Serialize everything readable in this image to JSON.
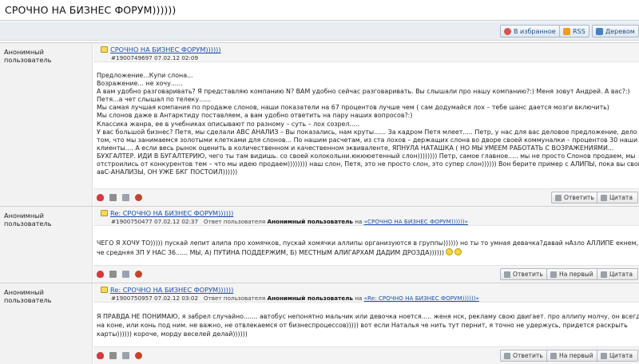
{
  "page": {
    "title": "СРОЧНО НА БИЗНЕС ФОРУМ))))))"
  },
  "actions": {
    "favorites": "В избранное",
    "rss": "RSS",
    "tree": "Деревом"
  },
  "labels": {
    "answered_by": "Ответ пользователя",
    "on": "на",
    "reply": "Ответить",
    "first": "На первый",
    "quote": "Цитата"
  },
  "posts": [
    {
      "author": "Анонимный пользователь",
      "subject": "СРОЧНО НА БИЗНЕС ФОРУМ))))))",
      "meta": "#1900749697 07.02.12 02:09",
      "lines": [
        "Предложение...Купи слона...",
        "Возражение... не хочу......",
        "А вам удобно разговаривать? Я представляю компанию N? ВАМ удобно сейчас разговаривать. Вы слышали про нашу компанию?:) Меня зовут Андрей. А вас?:)",
        "Петя...а чет слышал по телеку......",
        "Мы самая лучшая компания по продаже слонов, наши показатели на 67 процентов лучше чем ( сам додумайся лох – тебе шанс дается мозги включить)",
        "Мы слонов даже в Антарктиду поставляем, а вам удобно ответить на пару наших вопросов?:)",
        "Классика жанра, ее в учебниках описывают по разному – суть – лох созрел.....",
        "У вас большой бизнес? Петя, мы сделали АВС АНАЛИЗ – Вы показались, нам круты...... За кадром Петя млеет..... Петр, у нас для вас деловое предложение, дело в",
        "том, что мы занимаемся золотыми клетками для слонов... По нашим расчетам, из ста лохов – держащих слона во дворе своей коммуналки – процентов 30 наши",
        "клиенты.... А если весь рынок оценить в количественном и качественном эквиваленте, ЯПНУЛА НАТАШКА ( НО МЫ УМЕЕМ РАБОТАТЬ С ВОЗРАЖЕНИЯМИ...",
        "БУХГАЛТЕР. ИДИ В БУГАЛТЕРИЮ, чего ты там видишь. со своей колокольни.юкююетенный слон)))))))) Петр, самое главное..... мы не просто Слонов продаем, мы",
        "отстроились от конкурентов тем – что мы идею продаем)))))))) наш слон, Петя, это не просто слон, это супер слон)))))) Вон берите пример с АЛИПЫ, пока вы свои",
        "авС-АНАЛИЗЫ, ОН УЖЕ БКГ ПОСТОИЛ))))))"
      ]
    },
    {
      "author": "Анонимный пользователь",
      "subject": "Re: СРОЧНО НА БИЗНЕС ФОРУМ))))))",
      "meta_id": "#1900750477 07.02.12 02:37",
      "meta_user": "Анонимный пользователь",
      "meta_target": "«СРОЧНО НА БИЗНЕС ФОРУМ))))))»",
      "lines": [
        "ЧЕГО Я ХОЧУ ТО))))) пускай лепит алипа про хомячков, пускай хомячки аллипы организуются в группы)))))) но ты то умная девачка?давай нАзло АЛЛИПЕ екнем,",
        "че средняя ЗП У НАС 36...... МЫ, А) ПУТИНА ПОДДЕРЖИМ, Б) МЕСТНЫМ АЛИГАРХАМ ДАДИМ ДРОЗДА))))))"
      ]
    },
    {
      "author": "Анонимный пользователь",
      "subject": "Re: СРОЧНО НА БИЗНЕС ФОРУМ))))))",
      "meta_id": "#1900750957 07.02.12 03:02",
      "meta_user": "Анонимный пользователь",
      "meta_target": "«Re: СРОЧНО НА БИЗНЕС ФОРУМ))))))»",
      "lines": [
        "Я ПРАВДА НЕ ПОНИМАЮ, я забрел случайно....... автобус непонятно мальчик или девочка ноется..... женя нск, рекламу свою двигает. про аллипу молчу, он всегда",
        "на коне, или конь под ним. не важно, не отвлекаемся от бизнеспроцессов))))) вот если Наталья че нить тут пернит, я точно не удержусь, придется раскрыть",
        "карты)))))) короче, морду веселей делай))))))"
      ]
    }
  ]
}
